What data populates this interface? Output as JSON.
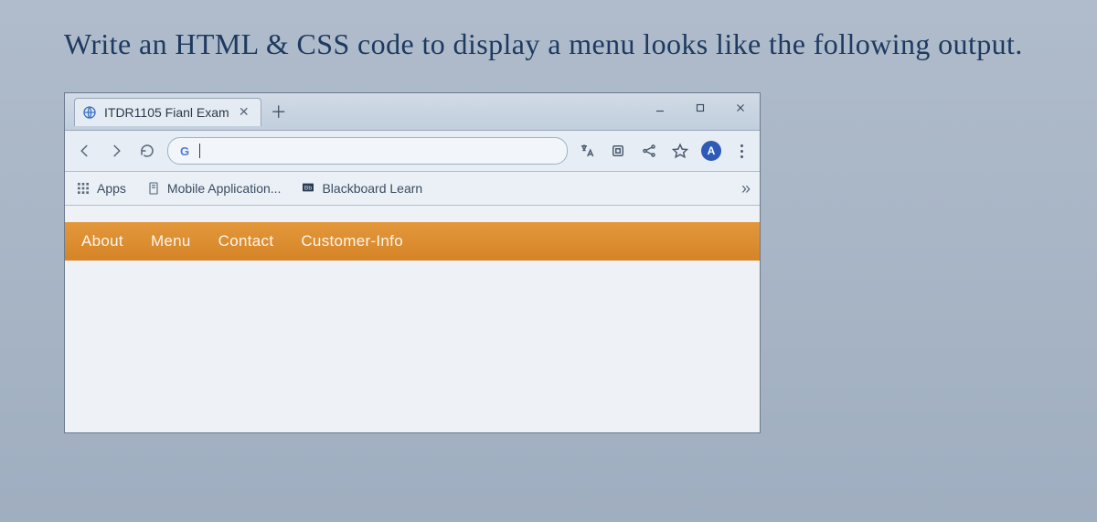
{
  "instruction": "Write an HTML & CSS code to display a menu looks like the following output.",
  "browser": {
    "tab": {
      "title": "ITDR1105 Fianl Exam"
    },
    "window_controls": {
      "minimize": "−",
      "maximize": "▢",
      "close": "✕"
    },
    "toolbar": {
      "omnibox_value": "",
      "profile_initial": "A"
    },
    "bookmarks": {
      "apps": "Apps",
      "mobile": "Mobile Application...",
      "blackboard": "Blackboard Learn"
    }
  },
  "page": {
    "menu": {
      "about": "About",
      "menu": "Menu",
      "contact": "Contact",
      "customer": "Customer-Info"
    }
  },
  "colors": {
    "menu_bg": "#d98a2b",
    "menu_text": "#ffffff"
  }
}
